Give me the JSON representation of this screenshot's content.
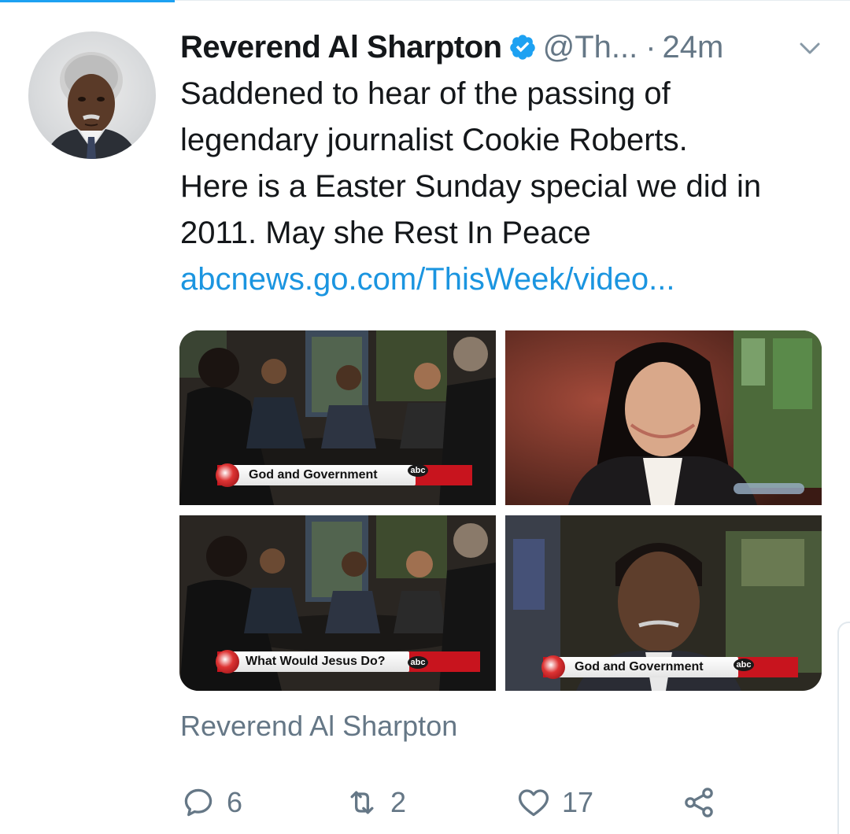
{
  "tweet": {
    "author_name": "Reverend Al Sharpton",
    "handle": "@Th...",
    "separator": "·",
    "time": "24m",
    "text": "Saddened to hear of the passing of\nlegendary journalist Cookie Roberts.\nHere is a Easter Sunday special we did in\n2011. May she Rest In Peace",
    "link": "abcnews.go.com/ThisWeek/video...",
    "source_label": "Reverend Al Sharpton"
  },
  "media": {
    "tiles": [
      {
        "lower_third": "God and Government",
        "logo": "abc"
      },
      {
        "lower_third": "",
        "logo": ""
      },
      {
        "lower_third": "What Would Jesus Do?",
        "logo": "abc"
      },
      {
        "lower_third": "God and Government",
        "logo": "abc"
      }
    ]
  },
  "actions": {
    "replies": "6",
    "retweets": "2",
    "likes": "17"
  },
  "icons": {
    "verified": "verified-badge-icon",
    "more": "chevron-down-icon",
    "reply": "reply-icon",
    "retweet": "retweet-icon",
    "like": "heart-icon",
    "share": "share-icon"
  },
  "colors": {
    "accent": "#1da1f2",
    "link": "#1b95e0",
    "secondary_text": "#657786",
    "primary_text": "#14171a"
  }
}
